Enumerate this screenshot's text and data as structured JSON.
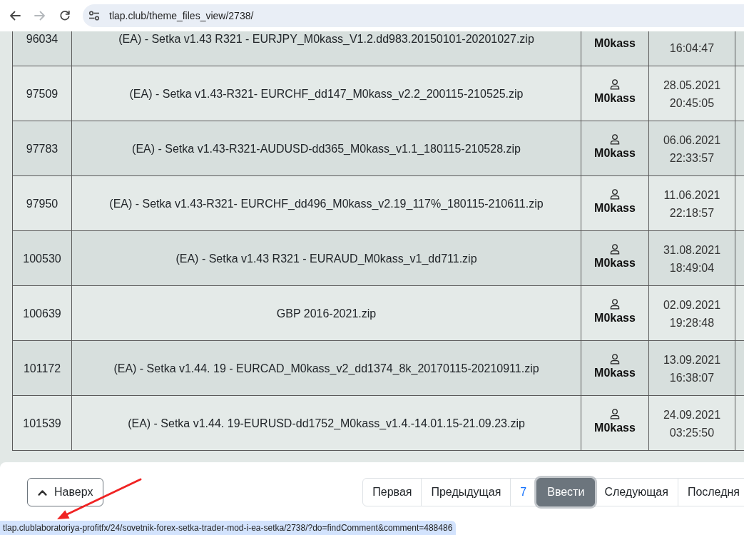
{
  "browser": {
    "nav_buttons": [
      {
        "kind": "back",
        "disabled": false
      },
      {
        "kind": "forward",
        "disabled": true
      },
      {
        "kind": "reload",
        "disabled": false
      }
    ],
    "url": "tlap.club/theme_files_view/2738/"
  },
  "files": {
    "rows": [
      {
        "id": "96034",
        "file": "(EA) - Setka v1.43 R321 - EURJPY_M0kass_V1.2.dd983.20150101-20201027.zip",
        "author": "M0kass",
        "time": "16:04:47"
      },
      {
        "id": "97509",
        "file": "(EA) - Setka v1.43-R321- EURCHF_dd147_M0kass_v2.2_200115-210525.zip",
        "author": "M0kass",
        "date": "28.05.2021",
        "time": "20:45:05"
      },
      {
        "id": "97783",
        "file": "(EA) - Setka v1.43-R321-AUDUSD-dd365_M0kass_v1.1_180115-210528.zip",
        "author": "M0kass",
        "date": "06.06.2021",
        "time": "22:33:57"
      },
      {
        "id": "97950",
        "file": "(EA) - Setka v1.43-R321- EURCHF_dd496_M0kass_v2.19_117%_180115-210611.zip",
        "author": "M0kass",
        "date": "11.06.2021",
        "time": "22:18:57"
      },
      {
        "id": "100530",
        "file": "(EA) - Setka v1.43 R321 - EURAUD_M0kass_v1_dd711.zip",
        "author": "M0kass",
        "date": "31.08.2021",
        "time": "18:49:04"
      },
      {
        "id": "100639",
        "file": "GBP 2016-2021.zip",
        "author": "M0kass",
        "date": "02.09.2021",
        "time": "19:28:48"
      },
      {
        "id": "101172",
        "file": "(EA) - Setka v1.44. 19 - EURCAD_M0kass_v2_dd1374_8k_20170115-20210911.zip",
        "author": "M0kass",
        "date": "13.09.2021",
        "time": "16:38:07"
      },
      {
        "id": "101539",
        "file": "(EA) - Setka v1.44. 19-EURUSD-dd1752_M0kass_v1.4.-14.01.15-21.09.23.zip",
        "author": "M0kass",
        "date": "24.09.2021",
        "time": "03:25:50"
      }
    ]
  },
  "footer": {
    "top_button": "Наверх",
    "pagination": [
      {
        "label": "Первая",
        "kind": "link",
        "focused": false
      },
      {
        "label": "Предыдущая",
        "kind": "link",
        "focused": false
      },
      {
        "label": "7",
        "kind": "number",
        "focused": false
      },
      {
        "label": "Ввести",
        "kind": "button",
        "focused": true
      },
      {
        "label": "Следующая",
        "kind": "link",
        "focused": false
      },
      {
        "label": "Последня",
        "kind": "link",
        "focused": false
      }
    ]
  },
  "status_bar": {
    "url": "tlap.clublaboratoriya-profitfx/24/sovetnik-forex-setka-trader-mod-i-ea-setka/2738/?do=findComment&comment=488486"
  },
  "annotations": [
    {
      "kind": "arrow"
    }
  ]
}
